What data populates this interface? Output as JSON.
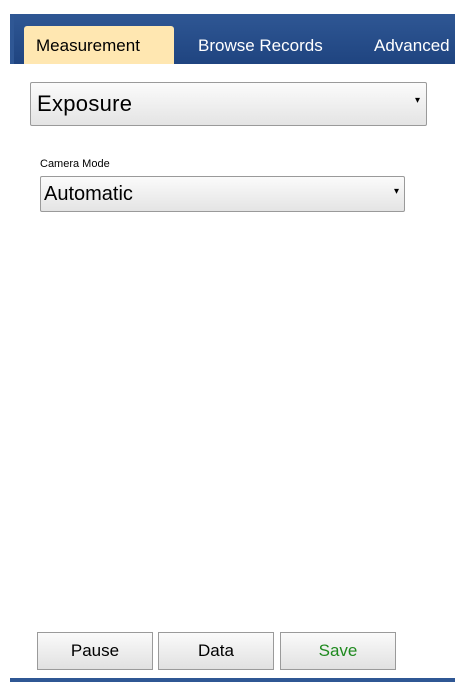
{
  "tabs": [
    {
      "label": "Measurement",
      "active": true
    },
    {
      "label": "Browse Records",
      "active": false
    },
    {
      "label": "Advanced",
      "active": false
    }
  ],
  "measurement_select": {
    "value": "Exposure"
  },
  "camera_mode": {
    "label": "Camera Mode",
    "value": "Automatic"
  },
  "buttons": {
    "pause": "Pause",
    "data": "Data",
    "save": "Save"
  },
  "colors": {
    "tab_bar": "#2f5794",
    "active_tab": "#ffe7b1",
    "save_text": "#1f8a1f"
  },
  "icons": {
    "dropdown": "chevron-down-icon"
  }
}
